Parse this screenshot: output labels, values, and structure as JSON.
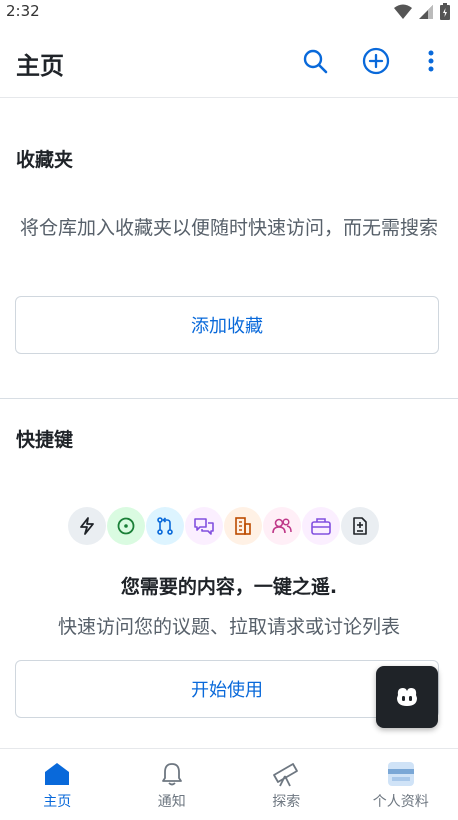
{
  "status_bar": {
    "time": "2:32"
  },
  "app_bar": {
    "title": "主页"
  },
  "favorites": {
    "title": "收藏夹",
    "description": "将仓库加入收藏夹以便随时快速访问，而无需搜索",
    "button_label": "添加收藏"
  },
  "shortcuts": {
    "title": "快捷键",
    "icons": [
      "zap-icon",
      "issue-icon",
      "pull-request-icon",
      "discussion-icon",
      "organization-icon",
      "people-icon",
      "briefcase-icon",
      "diff-icon"
    ],
    "tagline": "您需要的内容，一键之遥.",
    "subline": "快速访问您的议题、拉取请求或讨论列表",
    "button_label": "开始使用"
  },
  "bottom_nav": {
    "items": [
      {
        "label": "主页",
        "icon": "home-icon",
        "active": true
      },
      {
        "label": "通知",
        "icon": "bell-icon",
        "active": false
      },
      {
        "label": "探索",
        "icon": "telescope-icon",
        "active": false
      },
      {
        "label": "个人资料",
        "icon": "avatar-icon",
        "active": false
      }
    ]
  },
  "colors": {
    "accent": "#0969da",
    "text": "#1f2328",
    "muted": "#57606a",
    "border": "#d0d7de"
  }
}
